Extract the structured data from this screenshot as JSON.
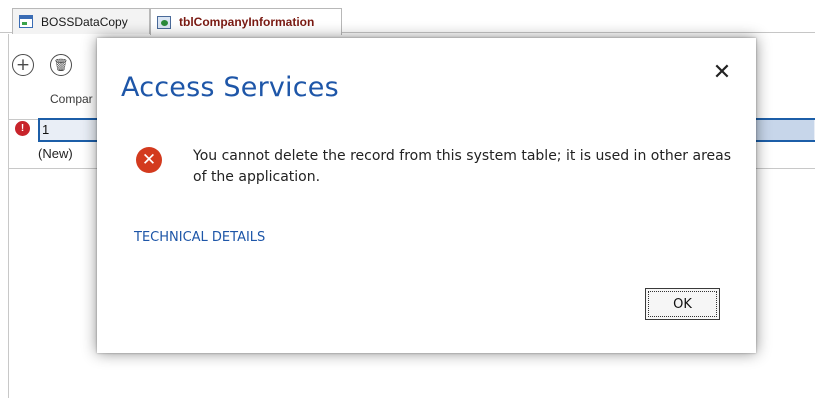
{
  "tabs": [
    {
      "label": "BOSSDataCopy"
    },
    {
      "label": "tblCompanyInformation"
    }
  ],
  "datasheet": {
    "add_symbol": "+",
    "delete_symbol": "🗑",
    "column_header": "Compar",
    "row_error_symbol": "!",
    "row1_value": "1",
    "new_row_label": "(New)"
  },
  "dialog": {
    "title": "Access Services",
    "close_symbol": "✕",
    "error_symbol": "✕",
    "message": "You cannot delete the record from this system table; it is used in other areas of the application.",
    "technical_details": "TECHNICAL DETAILS",
    "ok_label": "OK"
  },
  "colors": {
    "accent": "#1e56a8",
    "error": "#d33a1e",
    "active_tab_text": "#7a1a12"
  }
}
